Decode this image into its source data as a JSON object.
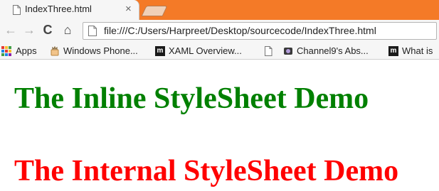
{
  "tab": {
    "title": "IndexThree.html",
    "close_glyph": "×",
    "favicon": "page-icon"
  },
  "toolbar": {
    "back_glyph": "←",
    "forward_glyph": "→",
    "reload_glyph": "C",
    "home_glyph": "⌂",
    "address": "file:///C:/Users/Harpreet/Desktop/sourcecode/IndexThree.html"
  },
  "bookmarks": [
    {
      "label": "Apps",
      "icon": "apps-grid-icon"
    },
    {
      "label": "Windows Phone...",
      "icon": "windows-phone-icon"
    },
    {
      "label": "XAML Overview...",
      "icon": "m-icon"
    },
    {
      "label": "",
      "icon": "page-icon"
    },
    {
      "label": "Channel9's Abs...",
      "icon": "channel9-icon"
    },
    {
      "label": "What is",
      "icon": "m-icon"
    }
  ],
  "content": {
    "inline_heading": "The Inline StyleSheet Demo",
    "internal_heading": "The Internal StyleSheet Demo"
  },
  "colors": {
    "tabstrip": "#f47a27",
    "inline_heading": "#008000",
    "internal_heading": "#ff0000",
    "apps_grid": [
      "#e53935",
      "#fbc02d",
      "#43a047",
      "#1e88e5",
      "#e53935",
      "#fbc02d",
      "#43a047",
      "#1e88e5",
      "#8e24aa"
    ]
  }
}
